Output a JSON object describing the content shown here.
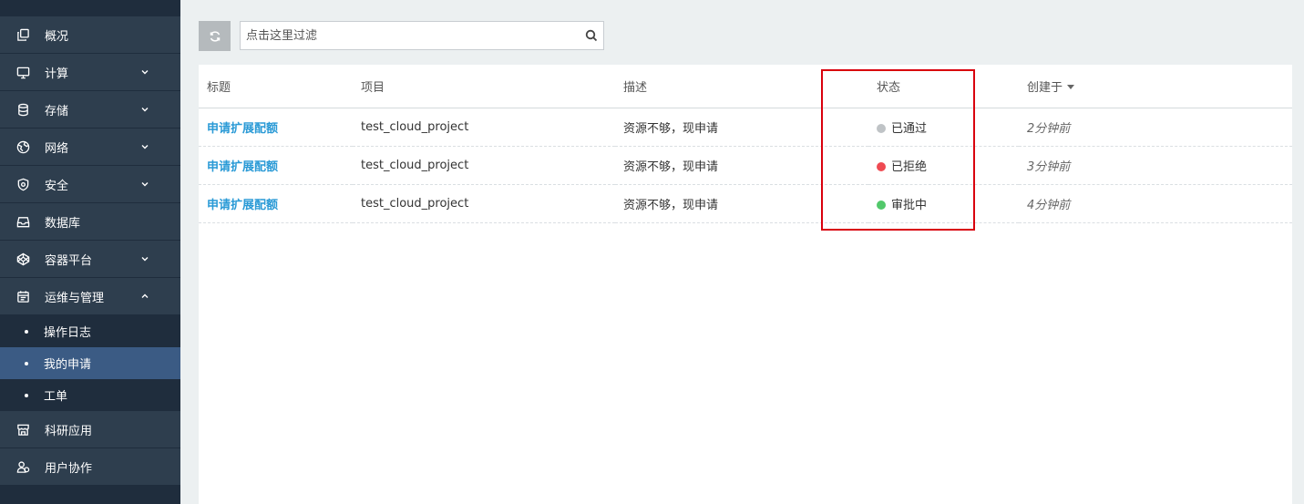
{
  "sidebar": {
    "items": [
      {
        "label": "概况",
        "icon": "copy-icon",
        "expandable": false
      },
      {
        "label": "计算",
        "icon": "monitor-icon",
        "expandable": true
      },
      {
        "label": "存储",
        "icon": "database-icon",
        "expandable": true
      },
      {
        "label": "网络",
        "icon": "globe-icon",
        "expandable": true
      },
      {
        "label": "安全",
        "icon": "shield-icon",
        "expandable": true
      },
      {
        "label": "数据库",
        "icon": "archive-icon",
        "expandable": false
      },
      {
        "label": "容器平台",
        "icon": "codepen-icon",
        "expandable": true
      },
      {
        "label": "运维与管理",
        "icon": "calendar-icon",
        "expandable": true,
        "expanded": true
      }
    ],
    "subitems": [
      {
        "label": "操作日志"
      },
      {
        "label": "我的申请",
        "active": true
      },
      {
        "label": "工单"
      }
    ],
    "bottom_items": [
      {
        "label": "科研应用",
        "icon": "store-icon"
      },
      {
        "label": "用户协作",
        "icon": "users-icon"
      }
    ]
  },
  "toolbar": {
    "refresh_icon": "refresh-icon",
    "search_placeholder": "点击这里过滤",
    "search_icon": "search-icon"
  },
  "table": {
    "columns": [
      "标题",
      "项目",
      "描述",
      "状态",
      "创建于"
    ],
    "sort_column": "创建于",
    "rows": [
      {
        "title": "申请扩展配额",
        "project": "test_cloud_project",
        "desc": "资源不够，现申请",
        "status": "已通过",
        "status_color": "#bfc3c6",
        "created": "2分钟前"
      },
      {
        "title": "申请扩展配额",
        "project": "test_cloud_project",
        "desc": "资源不够，现申请",
        "status": "已拒绝",
        "status_color": "#ef4a52",
        "created": "3分钟前"
      },
      {
        "title": "申请扩展配额",
        "project": "test_cloud_project",
        "desc": "资源不够，现申请",
        "status": "审批中",
        "status_color": "#52c86b",
        "created": "4分钟前"
      }
    ]
  },
  "colors": {
    "sidebar_bg": "#1f2d3d",
    "sidebar_item_bg": "#2e3e4e",
    "sidebar_active": "#3b5b84",
    "link": "#2a9ad6",
    "highlight": "#d9000d"
  }
}
